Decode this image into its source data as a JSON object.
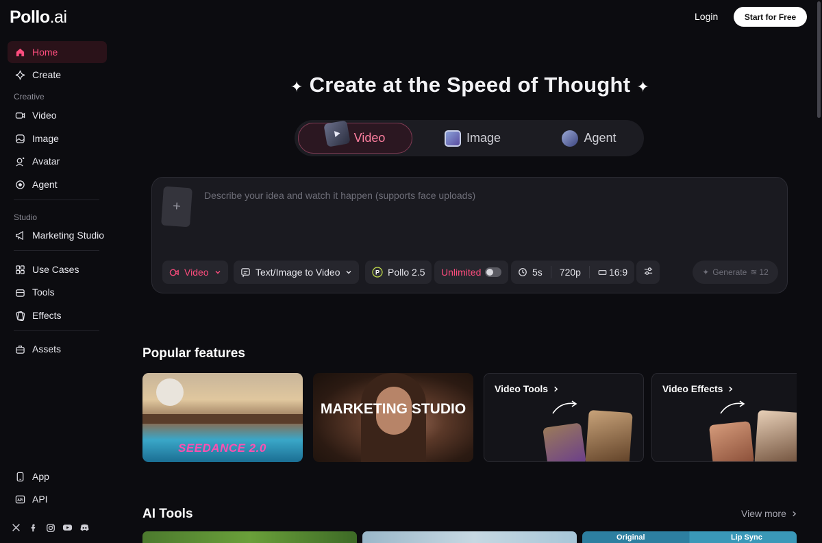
{
  "brand": {
    "name": "Pollo",
    "suffix": ".ai"
  },
  "header": {
    "login": "Login",
    "start": "Start for Free"
  },
  "sidebar": {
    "top": [
      {
        "label": "Home",
        "icon": "home-icon",
        "active": true
      },
      {
        "label": "Create",
        "icon": "sparkle-icon"
      }
    ],
    "creative_label": "Creative",
    "creative": [
      {
        "label": "Video",
        "icon": "video-icon"
      },
      {
        "label": "Image",
        "icon": "image-icon"
      },
      {
        "label": "Avatar",
        "icon": "avatar-icon"
      },
      {
        "label": "Agent",
        "icon": "agent-icon"
      }
    ],
    "studio_label": "Studio",
    "studio": [
      {
        "label": "Marketing Studio",
        "icon": "megaphone-icon"
      }
    ],
    "more": [
      {
        "label": "Use Cases",
        "icon": "grid-icon"
      },
      {
        "label": "Tools",
        "icon": "toolbox-icon"
      },
      {
        "label": "Effects",
        "icon": "cards-icon"
      }
    ],
    "assets": {
      "label": "Assets",
      "icon": "briefcase-icon"
    },
    "bottom": [
      {
        "label": "App",
        "icon": "phone-icon"
      },
      {
        "label": "API",
        "icon": "api-icon"
      }
    ],
    "socials": [
      "x-icon",
      "facebook-icon",
      "instagram-icon",
      "youtube-icon",
      "discord-icon"
    ]
  },
  "hero": {
    "title": "Create at the Speed of Thought",
    "tabs": [
      {
        "label": "Video",
        "active": true
      },
      {
        "label": "Image"
      },
      {
        "label": "Agent"
      }
    ]
  },
  "prompt": {
    "placeholder": "Describe your idea and watch it happen (supports face uploads)",
    "mode": "Video",
    "source": "Text/Image to Video",
    "model": "Pollo 2.5",
    "unlimited": "Unlimited",
    "duration": "5s",
    "resolution": "720p",
    "aspect": "16:9",
    "generate": "Generate",
    "credits": "12"
  },
  "popular": {
    "title": "Popular features",
    "cards": [
      {
        "label": "SEEDANCE 2.0"
      },
      {
        "label": "MARKETING STUDIO"
      },
      {
        "label": "Video Tools"
      },
      {
        "label": "Video Effects"
      }
    ]
  },
  "ai_tools": {
    "title": "AI Tools",
    "view_more": "View more",
    "labels": [
      "Original",
      "Lip Sync"
    ]
  },
  "colors": {
    "accent": "#ff4d7e",
    "background": "#0c0c10",
    "panel": "#1a1a20"
  }
}
